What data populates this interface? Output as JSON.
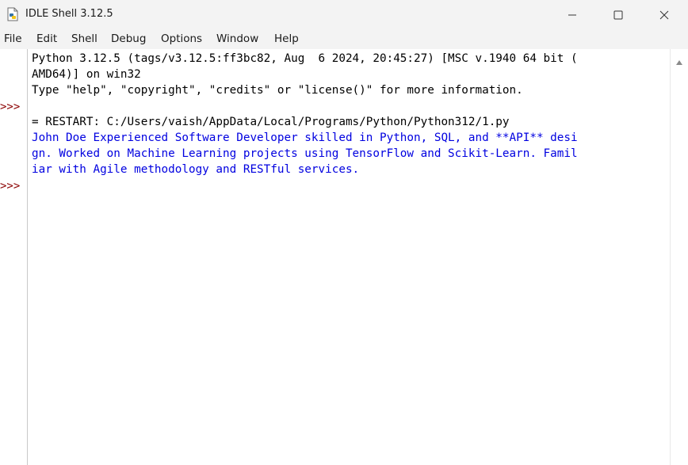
{
  "window": {
    "title": "IDLE Shell 3.12.5"
  },
  "menu": {
    "items": [
      "File",
      "Edit",
      "Shell",
      "Debug",
      "Options",
      "Window",
      "Help"
    ]
  },
  "shell": {
    "prompt": ">>>",
    "lines": [
      "Python 3.12.5 (tags/v3.12.5:ff3bc82, Aug  6 2024, 20:45:27) [MSC v.1940 64 bit (",
      "AMD64)] on win32",
      "Type \"help\", \"copyright\", \"credits\" or \"license()\" for more information.",
      "",
      "= RESTART: C:/Users/vaish/AppData/Local/Programs/Python/Python312/1.py",
      "John Doe Experienced Software Developer skilled in Python, SQL, and **API** desi",
      "gn. Worked on Machine Learning projects using TensorFlow and Scikit-Learn. Famil",
      "iar with Agile methodology and RESTful services."
    ]
  },
  "colors": {
    "prompt": "#8b0000",
    "output": "#0000e0",
    "chrome": "#f3f3f3"
  },
  "icons": {
    "app": "python-file-icon",
    "minimize": "minimize-icon",
    "maximize": "maximize-icon",
    "close": "close-icon",
    "scroll_up": "scroll-up-arrow-icon"
  }
}
